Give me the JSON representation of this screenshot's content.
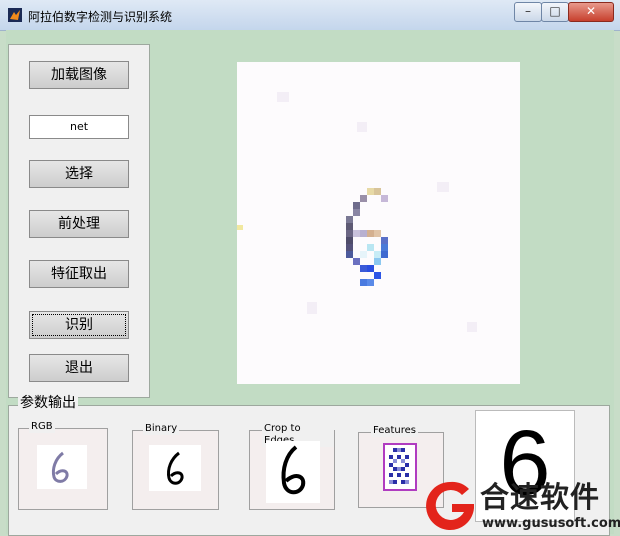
{
  "window": {
    "title": "阿拉伯数字检测与识别系统",
    "minimize_glyph": "–",
    "restore_glyph": "□",
    "close_glyph": "✕"
  },
  "controls": {
    "load_button": "加载图像",
    "method_field": "net",
    "select_button": "选择",
    "preprocess_button": "前处理",
    "features_button": "特征取出",
    "recognize_button": "识别",
    "exit_button": "退出"
  },
  "output": {
    "legend": "参数输出",
    "rgb_label": "RGB",
    "binary_label": "Binary",
    "crop_label": "Crop to Edges",
    "features_label": "Features",
    "result_digit": "6"
  },
  "watermark": {
    "text": "合速软件",
    "url": "www.gususoft.com"
  },
  "colors": {
    "background": "#c2dcc4",
    "panel": "#f0f0f0",
    "logo_red": "#e3241b"
  }
}
